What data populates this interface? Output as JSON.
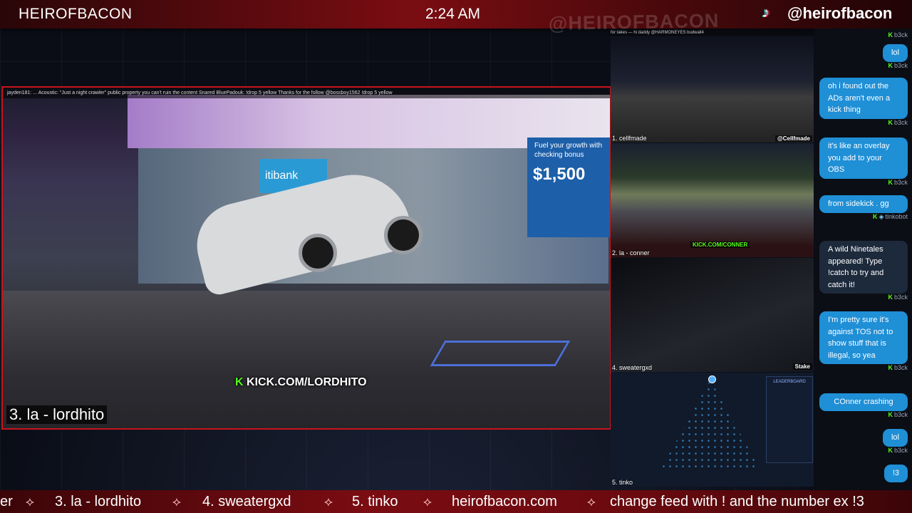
{
  "header": {
    "brand": "HEIROFBACON",
    "clock": "2:24 AM",
    "social_handle": "@heirofbacon",
    "tiktok_icon": "tiktok-icon",
    "watermark": "@HEIROFBACON"
  },
  "main_feed": {
    "label": "3. la - lordhito",
    "kick_tag": "KICK.COM/LORDHITO",
    "chat_overlay": "jayden181: ... Acoustic: \"Just a night crawler\" public property you can't ruin the content  Snared  BluePadouk: !drop 5 yellow  Thanks for the follow @bossboy1562  !drop 5 yellow",
    "ad_text_1": "Fuel your growth with",
    "ad_text_2": "checking bonus",
    "ad_price": "$1,500",
    "bank_sign": "itibank"
  },
  "side_feeds": [
    {
      "label": "1. cellfmade",
      "tag": "@Cellfmade",
      "chat": "for takes  — hi daddy @HARMONEYES  budwall4"
    },
    {
      "label": "2. la - conner",
      "tag": "KICK.COM/CONNER"
    },
    {
      "label": "4. sweatergxd",
      "tag": "Stake"
    },
    {
      "label": "5. tinko",
      "tag": "LEADERBOARD"
    }
  ],
  "chat": {
    "messages": [
      {
        "user": "b3ck",
        "text": "lol",
        "small": true
      },
      {
        "user": "b3ck",
        "text": "oh i found out the ADs aren't even a kick thing"
      },
      {
        "user": "b3ck",
        "text": "it's like an overlay you add to your OBS"
      },
      {
        "user": "b3ck",
        "text": "from sidekick . gg"
      },
      {
        "user": "tinkobot",
        "text": "A wild Ninetales appeared! Type !catch to try and catch it!",
        "bot": true
      },
      {
        "user": "b3ck",
        "text": "I'm pretty sure it's against TOS not to show stuff that is illegal, so yea"
      },
      {
        "user": "b3ck",
        "text": "COnner crashing"
      },
      {
        "user": "b3ck",
        "text": "lol",
        "small": true
      },
      {
        "user": "b3ck",
        "text": "!3",
        "small": true
      }
    ],
    "top_user": "b3ck"
  },
  "ticker": {
    "items": [
      "er",
      "3. la - lordhito",
      "4. sweatergxd",
      "5. tinko",
      "heirofbacon.com",
      "change feed with ! and the number ex !3"
    ]
  }
}
